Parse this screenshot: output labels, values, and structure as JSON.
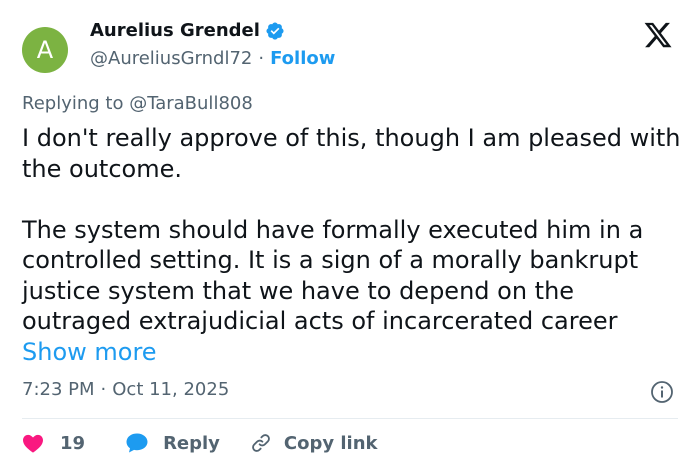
{
  "author": {
    "avatar_letter": "A",
    "avatar_color": "#7cb342",
    "display_name": "Aurelius Grendel",
    "verified": true,
    "handle": "@AureliusGrndl72",
    "separator": "·",
    "follow_label": "Follow"
  },
  "reply_to": {
    "prefix": "Replying to ",
    "mention": "@TaraBull808"
  },
  "tweet": {
    "paragraph_1": "I don't really approve of this, though I am pleased with the outcome.",
    "paragraph_2": "The system should have formally executed him in a controlled setting. It is a sign of a morally bankrupt justice system that we have to depend on the outraged extrajudicial acts of incarcerated career",
    "show_more": "Show more"
  },
  "meta": {
    "time": "7:23 PM",
    "separator": "·",
    "date": "Oct 11, 2025"
  },
  "actions": {
    "like_count": "19",
    "reply_label": "Reply",
    "copy_link_label": "Copy link"
  },
  "colors": {
    "accent": "#1d9bf0",
    "like": "#f91880",
    "text": "#0f1419",
    "muted": "#536471"
  },
  "icons": [
    "verified-badge-icon",
    "x-logo-icon",
    "info-icon",
    "heart-icon",
    "reply-bubble-icon",
    "link-icon"
  ]
}
